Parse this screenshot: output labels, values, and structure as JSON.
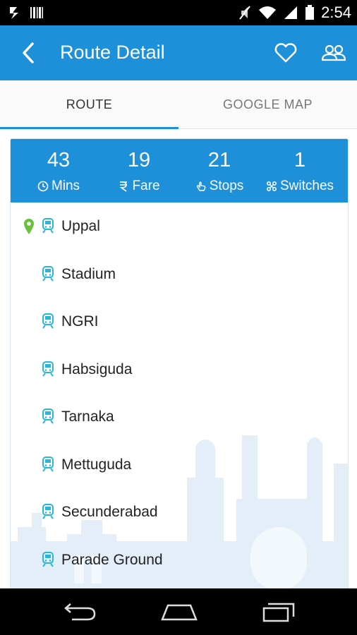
{
  "status_bar": {
    "time": "2:54",
    "icons": [
      "notification-icon",
      "barcode-icon",
      "mute-icon",
      "wifi-icon",
      "signal-icon",
      "battery-icon"
    ]
  },
  "app_bar": {
    "title": "Route Detail",
    "icons": [
      "back-arrow-icon",
      "heart-icon",
      "group-icon"
    ],
    "color": "#1e8fd9"
  },
  "tabs": [
    {
      "label": "ROUTE",
      "active": true
    },
    {
      "label": "GOOGLE MAP",
      "active": false
    }
  ],
  "summary": {
    "mins": {
      "value": "43",
      "label": "Mins",
      "icon": "clock-icon"
    },
    "fare": {
      "value": "19",
      "label": "Fare",
      "icon": "rupee-icon"
    },
    "stops": {
      "value": "21",
      "label": "Stops",
      "icon": "hand-icon"
    },
    "switches": {
      "value": "1",
      "label": "Switches",
      "icon": "switch-icon"
    }
  },
  "stops": [
    {
      "name": "Uppal",
      "origin": true
    },
    {
      "name": "Stadium"
    },
    {
      "name": "NGRI"
    },
    {
      "name": "Habsiguda"
    },
    {
      "name": "Tarnaka"
    },
    {
      "name": "Mettuguda"
    },
    {
      "name": "Secunderabad"
    },
    {
      "name": "Parade Ground"
    }
  ],
  "colors": {
    "accent": "#1e8fd9",
    "train_icon": "#29b6d8",
    "origin_pin": "#6abf3c"
  }
}
